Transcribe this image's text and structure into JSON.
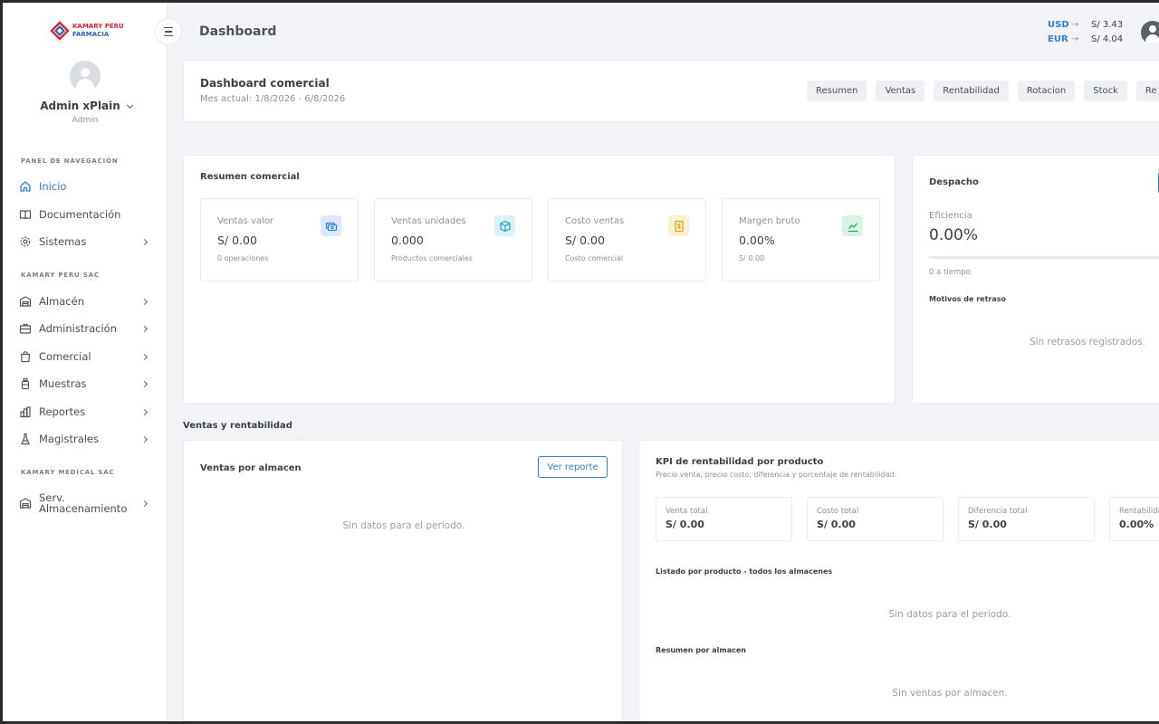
{
  "brand": {
    "line1": "KAMARY PERU",
    "line2": "FARMACIA"
  },
  "user": {
    "name": "Admin xPlain",
    "role": "Admin"
  },
  "nav": {
    "section_navigation": "PANEL DE NAVEGACIÓN",
    "inicio": "Inicio",
    "documentacion": "Documentación",
    "sistemas": "Sistemas",
    "section_kamary_peru": "KAMARY PERU SAC",
    "almacen": "Almacén",
    "administracion": "Administración",
    "comercial": "Comercial",
    "muestras": "Muestras",
    "reportes": "Reportes",
    "magistrales": "Magistrales",
    "section_kamary_medical": "KAMARY MEDICAL SAC",
    "serv_line1": "Serv.",
    "serv_line2": "Almacenamiento"
  },
  "header": {
    "title": "Dashboard",
    "rates": [
      {
        "currency": "USD",
        "arrow": "→",
        "value": "S/ 3.43"
      },
      {
        "currency": "EUR",
        "arrow": "→",
        "value": "S/ 4.04"
      }
    ]
  },
  "dash_header": {
    "title": "Dashboard comercial",
    "subtitle": "Mes actual: 1/8/2026 - 6/8/2026",
    "tabs": [
      "Resumen",
      "Ventas",
      "Rentabilidad",
      "Rotacion",
      "Stock",
      "Re"
    ]
  },
  "resumen": {
    "title": "Resumen comercial",
    "kpis": [
      {
        "label": "Ventas valor",
        "value": "S/ 0.00",
        "sub": "0 operaciones"
      },
      {
        "label": "Ventas unidades",
        "value": "0.000",
        "sub": "Productos comerciales"
      },
      {
        "label": "Costo ventas",
        "value": "S/ 0.00",
        "sub": "Costo comercial"
      },
      {
        "label": "Margen bruto",
        "value": "0.00%",
        "sub": "S/ 0.00"
      }
    ]
  },
  "despacho": {
    "title": "Despacho",
    "eff_label": "Eficiencia",
    "eff_value": "0.00%",
    "on_time": "0 a tiempo",
    "delays_title": "Motivos de retraso",
    "empty": "Sin retrasos registrados."
  },
  "ventas_rent": {
    "section": "Ventas y rentabilidad",
    "por_almacen_title": "Ventas por almacen",
    "ver_reporte": "Ver reporte",
    "por_almacen_empty": "Sin datos para el periodo."
  },
  "kpi_rent": {
    "title": "KPI de rentabilidad por producto",
    "subtitle": "Precio venta, precio costo, diferencia y porcentaje de rentabilidad.",
    "minis": [
      {
        "label": "Venta total",
        "value": "S/ 0.00"
      },
      {
        "label": "Costo total",
        "value": "S/ 0.00"
      },
      {
        "label": "Diferencia total",
        "value": "S/ 0.00"
      },
      {
        "label": "Rentabilidad",
        "value": "0.00%"
      }
    ],
    "listado_title": "Listado por producto - todos los almacenes",
    "listado_empty": "Sin datos para el periodo.",
    "resumen_title": "Resumen por almacen",
    "resumen_empty": "Sin ventas por almacen."
  }
}
